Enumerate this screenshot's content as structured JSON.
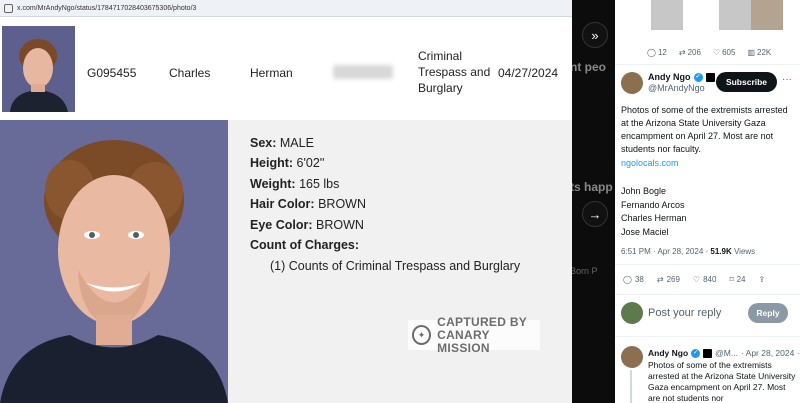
{
  "browser": {
    "url": "x.com/MrAndyNgo/status/1784717028403675306/photo/3"
  },
  "record": {
    "id": "G095455",
    "first_name": "Charles",
    "last_name": "Herman",
    "charge": "Criminal Trespass and Burglary",
    "date": "04/27/2024"
  },
  "details": {
    "sex_label": "Sex:",
    "sex": "MALE",
    "height_label": "Height:",
    "height": "6'02''",
    "weight_label": "Weight:",
    "weight": "165 lbs",
    "hair_label": "Hair Color:",
    "hair": "BROWN",
    "eye_label": "Eye Color:",
    "eye": "BROWN",
    "charges_label": "Count of Charges:",
    "charges_line": "(1) Counts of Criminal Trespass and Burglary"
  },
  "watermark": {
    "line1": "CAPTURED BY",
    "line2": "CANARY MISSION"
  },
  "midstrip": {
    "snippet1": "nt peo",
    "snippet2": "ts happ",
    "snippet3": "Born P"
  },
  "tweet": {
    "top_stats": {
      "replies": "12",
      "reposts": "206",
      "likes": "605",
      "views": "22K"
    },
    "author_name": "Andy Ngo",
    "author_handle": "@MrAndyNgo",
    "subscribe_label": "Subscribe",
    "more_label": "···",
    "text": "Photos of some of the extremists arrested at the Arizona State University Gaza encampment on April 27. Most are not students nor faculty.",
    "link": "ngolocals.com",
    "names": [
      "John Bogle",
      "Fernando Arcos",
      "Charles Herman",
      "Jose Maciel"
    ],
    "time": "6:51 PM · Apr 28, 2024 · ",
    "views_count": "51.9K",
    "views_label": " Views",
    "actions": {
      "replies": "38",
      "reposts": "269",
      "likes": "840",
      "bookmarks": "24"
    },
    "reply_placeholder": "Post your reply",
    "reply_button": "Reply"
  },
  "reply_tweet": {
    "author": "Andy Ngo",
    "handle": "@M...",
    "date": "· Apr 28, 2024 ·",
    "text": "Photos of some of the extremists arrested at the Arizona State University Gaza encampment on April 27. Most are not students nor"
  },
  "colors": {
    "accent": "#1d9bf0",
    "dark": "#0f1419",
    "muted": "#536471"
  }
}
